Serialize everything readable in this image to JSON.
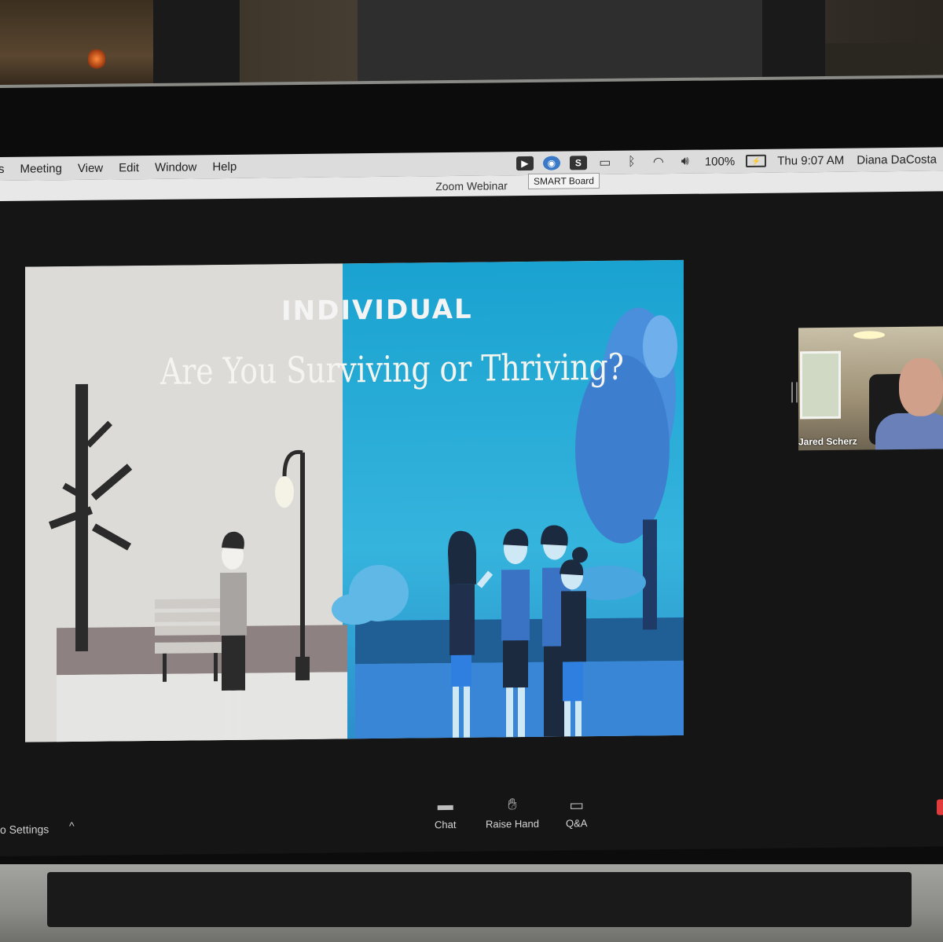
{
  "menubar": {
    "items": [
      "s",
      "Meeting",
      "View",
      "Edit",
      "Window",
      "Help"
    ],
    "status": {
      "battery": "100%",
      "clock": "Thu 9:07 AM",
      "user": "Diana DaCosta"
    },
    "icons": [
      "zoom-icon",
      "smart-board-icon",
      "s-icon",
      "airplay-icon",
      "bluetooth-icon",
      "wifi-icon",
      "volume-icon",
      "battery-icon"
    ]
  },
  "window": {
    "title": "Zoom Webinar"
  },
  "tooltip": "SMART Board",
  "slide": {
    "label": "INDIVIDUAL",
    "title": "Are You Surviving or Thriving?"
  },
  "speaker": {
    "name": "Jared Scherz"
  },
  "controls": {
    "settings": "o Settings",
    "caret": "^",
    "chat": "Chat",
    "raise_hand": "Raise Hand",
    "qa": "Q&A"
  },
  "colors": {
    "slide_gray": "#dcdbd7",
    "slide_blue": "#1aa2d0",
    "walk_blue": "#1f5f96",
    "walk_gray": "#8d8281"
  }
}
